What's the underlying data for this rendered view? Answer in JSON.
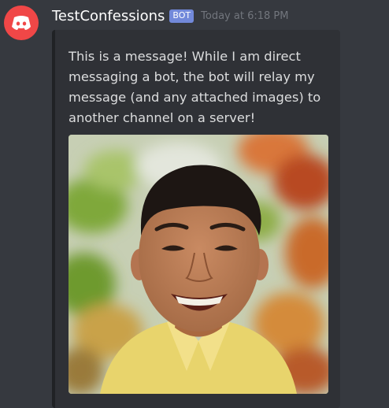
{
  "author": {
    "name": "TestConfessions",
    "tag": "BOT",
    "timestamp": "Today at 6:18 PM",
    "avatar_icon": "discord-logo-icon",
    "avatar_color": "#f04747"
  },
  "embed": {
    "description": "This is a message! While I am direct messaging a bot, the bot will relay my message (and any attached images) to another channel on a server!",
    "image": "photo of a smiling young man in a yellow shirt in front of autumn leaves"
  },
  "colors": {
    "background": "#36393f",
    "embed_bg": "#2f3136",
    "bot_tag": "#7289da",
    "timestamp": "#72767d"
  }
}
